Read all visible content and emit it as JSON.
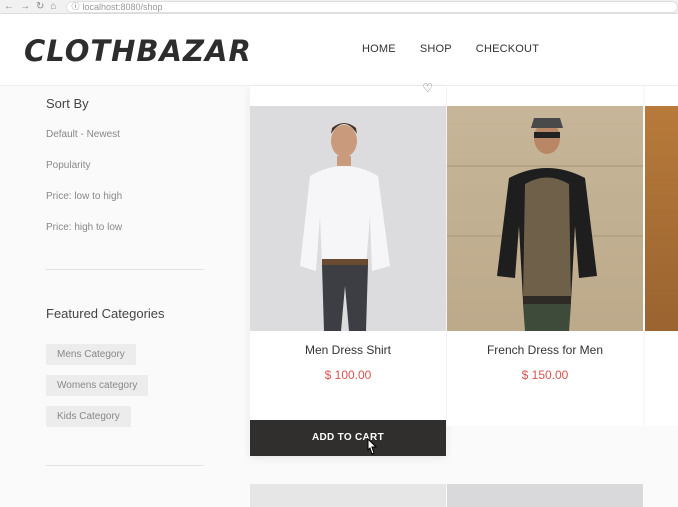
{
  "browser": {
    "url": "localhost:8080/shop"
  },
  "brand": {
    "logo": "CLOTHBAZAR"
  },
  "nav": {
    "items": [
      "HOME",
      "SHOP",
      "CHECKOUT"
    ]
  },
  "sidebar": {
    "sort_title": "Sort By",
    "sort_options": [
      "Default - Newest",
      "Popularity",
      "Price: low to high",
      "Price: high to low"
    ],
    "featured_title": "Featured Categories",
    "categories": [
      "Mens Category",
      "Womens category",
      "Kids Category"
    ]
  },
  "products": [
    {
      "name": "Men Dress Shirt",
      "price": "$ 100.00",
      "button": "ADD TO CART"
    },
    {
      "name": "French Dress for Men",
      "price": "$ 150.00"
    }
  ],
  "colors": {
    "price": "#d9534f",
    "button_bg": "#302f2d"
  },
  "icons": [
    "heart-icon",
    "back-icon",
    "forward-icon",
    "refresh-icon",
    "home-icon",
    "info-icon",
    "cursor-icon"
  ]
}
